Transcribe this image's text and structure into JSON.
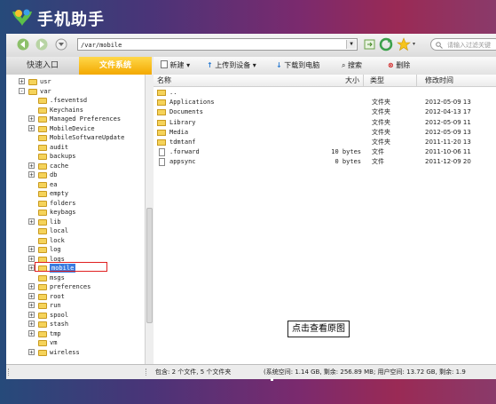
{
  "app": {
    "title": "手机助手"
  },
  "address": {
    "path": "/var/mobile",
    "search_placeholder": "请输入过滤关键"
  },
  "tabs": [
    {
      "label": "快速入口"
    },
    {
      "label": "文件系统"
    }
  ],
  "toolbar": {
    "new_label": "新建",
    "upload_label": "上传到设备",
    "download_label": "下载到电脑",
    "search_label": "搜索",
    "delete_label": "删除"
  },
  "tree": [
    {
      "label": "usr",
      "depth": 0,
      "exp": "+"
    },
    {
      "label": "var",
      "depth": 0,
      "exp": "-"
    },
    {
      "label": ".fseventsd",
      "depth": 1,
      "exp": ""
    },
    {
      "label": "Keychains",
      "depth": 1,
      "exp": ""
    },
    {
      "label": "Managed Preferences",
      "depth": 1,
      "exp": "+"
    },
    {
      "label": "MobileDevice",
      "depth": 1,
      "exp": "+"
    },
    {
      "label": "MobileSoftwareUpdate",
      "depth": 1,
      "exp": ""
    },
    {
      "label": "audit",
      "depth": 1,
      "exp": ""
    },
    {
      "label": "backups",
      "depth": 1,
      "exp": ""
    },
    {
      "label": "cache",
      "depth": 1,
      "exp": "+"
    },
    {
      "label": "db",
      "depth": 1,
      "exp": "+"
    },
    {
      "label": "ea",
      "depth": 1,
      "exp": ""
    },
    {
      "label": "empty",
      "depth": 1,
      "exp": ""
    },
    {
      "label": "folders",
      "depth": 1,
      "exp": ""
    },
    {
      "label": "keybags",
      "depth": 1,
      "exp": ""
    },
    {
      "label": "lib",
      "depth": 1,
      "exp": "+"
    },
    {
      "label": "local",
      "depth": 1,
      "exp": ""
    },
    {
      "label": "lock",
      "depth": 1,
      "exp": ""
    },
    {
      "label": "log",
      "depth": 1,
      "exp": "+"
    },
    {
      "label": "logs",
      "depth": 1,
      "exp": "+"
    },
    {
      "label": "mobile",
      "depth": 1,
      "exp": "+",
      "selected": true
    },
    {
      "label": "msgs",
      "depth": 1,
      "exp": ""
    },
    {
      "label": "preferences",
      "depth": 1,
      "exp": "+"
    },
    {
      "label": "root",
      "depth": 1,
      "exp": "+"
    },
    {
      "label": "run",
      "depth": 1,
      "exp": "+"
    },
    {
      "label": "spool",
      "depth": 1,
      "exp": "+"
    },
    {
      "label": "stash",
      "depth": 1,
      "exp": "+"
    },
    {
      "label": "tmp",
      "depth": 1,
      "exp": "+"
    },
    {
      "label": "vm",
      "depth": 1,
      "exp": ""
    },
    {
      "label": "wireless",
      "depth": 1,
      "exp": "+"
    }
  ],
  "list": {
    "headers": {
      "name": "名称",
      "size": "大小",
      "type": "类型",
      "modified": "修改时间"
    },
    "rows": [
      {
        "name": "..",
        "size": "",
        "type": "",
        "modified": "",
        "kind": "folder"
      },
      {
        "name": "Applications",
        "size": "",
        "type": "文件夹",
        "modified": "2012-05-09 13",
        "kind": "folder"
      },
      {
        "name": "Documents",
        "size": "",
        "type": "文件夹",
        "modified": "2012-04-13 17",
        "kind": "folder"
      },
      {
        "name": "Library",
        "size": "",
        "type": "文件夹",
        "modified": "2012-05-09 11",
        "kind": "folder"
      },
      {
        "name": "Media",
        "size": "",
        "type": "文件夹",
        "modified": "2012-05-09 13",
        "kind": "folder"
      },
      {
        "name": "tdmtanf",
        "size": "",
        "type": "文件夹",
        "modified": "2011-11-20 13",
        "kind": "folder"
      },
      {
        "name": ".forward",
        "size": "10 bytes",
        "type": "文件",
        "modified": "2011-10-06 11",
        "kind": "file"
      },
      {
        "name": "appsync",
        "size": "0 bytes",
        "type": "文件",
        "modified": "2011-12-09 20",
        "kind": "file"
      }
    ]
  },
  "status": {
    "summary": "包含: 2 个文件, 5 个文件夹",
    "space": "(系统空间: 1.14 GB, 剩余: 256.89 MB; 用户空间: 13.72 GB, 剩余: 1.9"
  },
  "tooltip": {
    "text": "点击查看原图"
  },
  "colors": {
    "accent": "#f3a800",
    "selection": "#3a7be0",
    "folder": "#f5d35a"
  }
}
